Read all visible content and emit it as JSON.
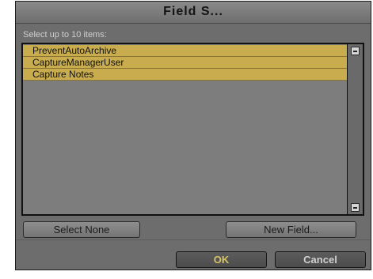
{
  "dialog": {
    "title": "Field S..."
  },
  "instruction": "Select up to 10 items:",
  "list": {
    "items": [
      {
        "label": "PreventAutoArchive",
        "selected": true
      },
      {
        "label": "CaptureManagerUser",
        "selected": true
      },
      {
        "label": "Capture Notes",
        "selected": true
      }
    ]
  },
  "buttons": {
    "select_none": "Select None",
    "new_field": "New Field...",
    "ok": "OK",
    "cancel": "Cancel"
  },
  "colors": {
    "dialog_bg": "#6d6d6d",
    "selection": "#c9ac4d",
    "ok_text": "#d8c46a"
  },
  "icons": {
    "scroll_up": "scroll-up-icon",
    "scroll_down": "scroll-down-icon"
  }
}
